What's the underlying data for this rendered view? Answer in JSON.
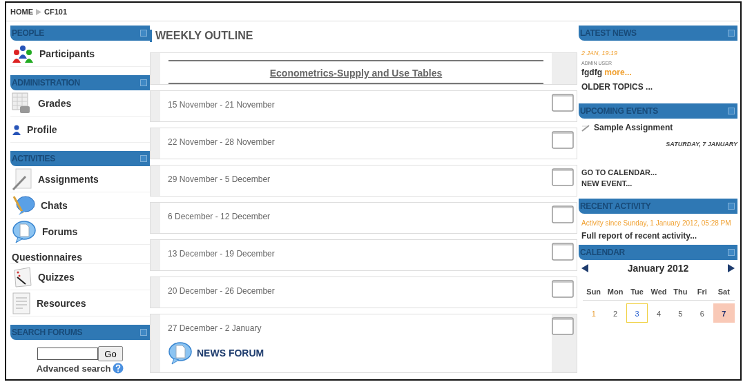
{
  "breadcrumb": [
    {
      "label": "HOME"
    },
    {
      "label": "CF101"
    }
  ],
  "left_blocks": [
    {
      "title": "PEOPLE",
      "items": [
        {
          "label": "Participants",
          "kind": "people"
        }
      ]
    },
    {
      "title": "ADMINISTRATION",
      "items": [
        {
          "label": "Grades",
          "kind": "grades"
        },
        {
          "label": "Profile",
          "kind": "profile"
        }
      ]
    },
    {
      "title": "ACTIVITIES",
      "items": [
        {
          "label": "Assignments",
          "kind": "assignment"
        },
        {
          "label": "Chats",
          "kind": "chat"
        },
        {
          "label": "Forums",
          "kind": "forum"
        },
        {
          "label": "Questionnaires",
          "kind": "none"
        },
        {
          "label": "Quizzes",
          "kind": "quiz"
        },
        {
          "label": "Resources",
          "kind": "resource"
        }
      ]
    }
  ],
  "search_forums": {
    "title": "SEARCH FORUMS",
    "button": "Go",
    "link": "Advanced search"
  },
  "outline": {
    "title": "WEEKLY OUTLINE",
    "summary": "Econometrics-Supply and Use Tables",
    "weeks": [
      {
        "dates": "15 November - 21 November"
      },
      {
        "dates": "22 November - 28 November"
      },
      {
        "dates": "29 November - 5 December"
      },
      {
        "dates": "6 December - 12 December"
      },
      {
        "dates": "13 December - 19 December"
      },
      {
        "dates": "20 December - 26 December"
      },
      {
        "dates": "27 December - 2 January",
        "activities": [
          {
            "label": "NEWS FORUM",
            "kind": "forum"
          }
        ]
      }
    ]
  },
  "latest_news": {
    "title": "LATEST NEWS",
    "date": "2 JAN, 19:19",
    "author": "ADMIN USER",
    "text": "fgdfg",
    "more": "more...",
    "older": "OLDER TOPICS ..."
  },
  "upcoming_events": {
    "title": "UPCOMING EVENTS",
    "event": "Sample Assignment",
    "date": "SATURDAY, 7 JANUARY",
    "links": [
      "GO TO CALENDAR...",
      "NEW EVENT..."
    ]
  },
  "recent_activity": {
    "title": "RECENT ACTIVITY",
    "since": "Activity since Sunday, 1 January 2012, 05:28 PM",
    "link": "Full report of recent activity..."
  },
  "calendar": {
    "title": "CALENDAR",
    "month": "January 2012",
    "weekdays": [
      "Sun",
      "Mon",
      "Tue",
      "Wed",
      "Thu",
      "Fri",
      "Sat"
    ],
    "days": [
      {
        "day": "1",
        "weekend": true,
        "today": false,
        "event": false
      },
      {
        "day": "2",
        "weekend": false,
        "today": false,
        "event": false
      },
      {
        "day": "3",
        "weekend": false,
        "today": true,
        "event": false
      },
      {
        "day": "4",
        "weekend": false,
        "today": false,
        "event": false
      },
      {
        "day": "5",
        "weekend": false,
        "today": false,
        "event": false
      },
      {
        "day": "6",
        "weekend": false,
        "today": false,
        "event": false
      },
      {
        "day": "7",
        "weekend": true,
        "today": false,
        "event": true
      }
    ]
  }
}
